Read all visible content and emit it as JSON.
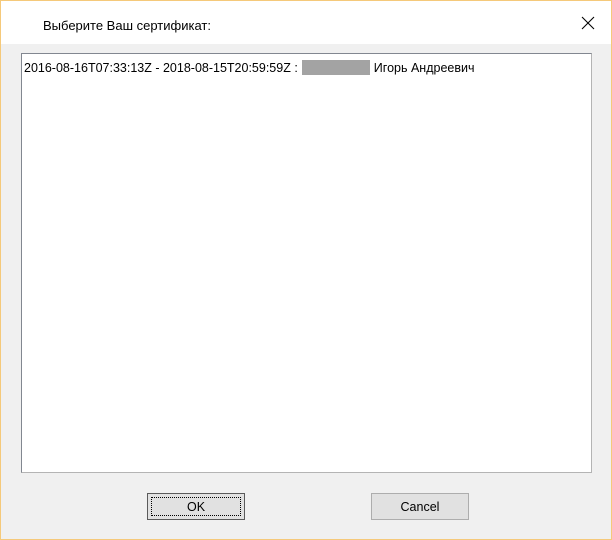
{
  "window": {
    "title": "Выберите Ваш сертификат:",
    "close_icon": "close-icon"
  },
  "certificate_list": {
    "items": [
      {
        "validity": "2016-08-16T07:33:13Z - 2018-08-15T20:59:59Z :",
        "owner": "Игорь Андреевич"
      }
    ]
  },
  "buttons": {
    "ok_label": "OK",
    "cancel_label": "Cancel"
  },
  "colors": {
    "window_border": "#f5c97a",
    "dialog_background": "#f0f0f0",
    "redaction": "#a3a3a3"
  }
}
